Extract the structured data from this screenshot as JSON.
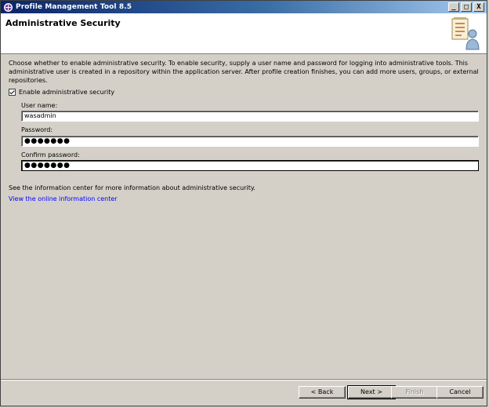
{
  "window": {
    "title": "Profile Management Tool 8.5",
    "caption_buttons": [
      "_",
      "□",
      "X"
    ]
  },
  "header": {
    "title": "Administrative Security",
    "graphic_icon": "checklist-user-icon"
  },
  "main": {
    "description": "Choose whether to enable administrative security. To enable security, supply a user name and password for logging into administrative tools. This administrative user is created in a repository within the application server. After profile creation finishes, you can add more users, groups, or external repositories.",
    "enable_checkbox": {
      "label": "Enable administrative security",
      "checked": true
    },
    "user_name": {
      "label": "User name:",
      "value": "wasadmin"
    },
    "password": {
      "label": "Password:",
      "value": "●●●●●●●"
    },
    "confirm_password": {
      "label": "Confirm password:",
      "value": "●●●●●●●"
    },
    "info_text": "See the information center for more information about administrative security.",
    "info_link": "View the online information center"
  },
  "footer": {
    "back_label": "< Back",
    "next_label": "Next >",
    "finish_label": "Finish",
    "cancel_label": "Cancel"
  },
  "colors": {
    "titlebar_start": "#0a246a",
    "titlebar_end": "#a6caf0",
    "dialog_bg": "#d4d0c8",
    "link": "#0000ff"
  }
}
